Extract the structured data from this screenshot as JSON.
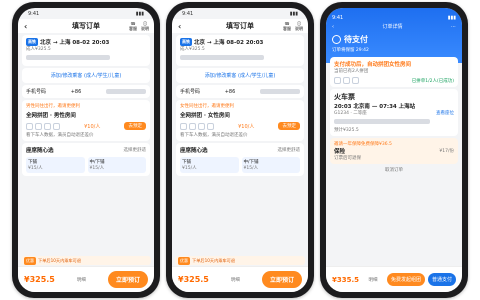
{
  "phone1": {
    "time": "9:41",
    "title": "填写订单",
    "tools": [
      "客服",
      "说明"
    ],
    "trip": "北京 → 上海  08-02 20:03",
    "train_tag": "高铁",
    "price_line": "成人¥325.5",
    "add_passenger": "添加/修改乘客 (成人/学生/儿童)",
    "phone_label": "手机号码",
    "phone_prefix": "+86",
    "room_hint": "男性同住出行，邀请更便利",
    "room_title": "全网拼团 · 男性房间",
    "room_price": "¥10/人",
    "room_btn": "去预定",
    "room_note": "看下车人数据，满员自动退还差价",
    "seat_title": "座席随心选",
    "seat_hint": "选择更舒适",
    "seat_opts": [
      {
        "name": "下铺",
        "price": "¥15/人"
      },
      {
        "name": "中/下铺",
        "price": "¥15/人"
      }
    ],
    "promo": "下单后10天内乘车可退",
    "promo_badge": "优惠",
    "total": "¥325.5",
    "detail": "明细",
    "cta": "立即预订"
  },
  "phone2": {
    "time": "9:41",
    "title": "填写订单",
    "tools": [
      "客服",
      "说明"
    ],
    "trip": "北京 → 上海  08-02 20:03",
    "train_tag": "高铁",
    "price_line": "成人¥325.5",
    "add_passenger": "添加/修改乘客 (成人/学生/儿童)",
    "phone_label": "手机号码",
    "phone_prefix": "+86",
    "room_hint": "女性同住出行，邀请更便利",
    "room_title": "全网拼团 · 女性房间",
    "room_price": "¥10/人",
    "room_btn": "去预定",
    "room_note": "看下车人数据，满员自动退还差价",
    "seat_title": "座席随心选",
    "seat_hint": "选择更舒适",
    "seat_opts": [
      {
        "name": "下铺",
        "price": "¥15/人"
      },
      {
        "name": "中/下铺",
        "price": "¥15/人"
      }
    ],
    "promo": "下单后10天内乘车可退",
    "promo_badge": "优惠",
    "total": "¥325.5",
    "detail": "明细",
    "cta": "立即预订"
  },
  "phone3": {
    "time": "9:41",
    "title": "订单详情",
    "pay_status": "待支付",
    "pay_sub": "订单将保留 29:42",
    "match_title": "支付成功后，自动拼团女性房间",
    "match_sub": "当前已有2人拼团",
    "match_progress": "已拼单1/2人(已成功)",
    "train_title": "火车票",
    "train_line": "20:03 北京南 — 07:34 上海站",
    "train_sub": "G1234 · 二等座",
    "seat_info": "查看座位",
    "refund_label": "预计¥325.5",
    "promo_banner": "邀请一年保障免费保障¥36.5",
    "insurance_title": "保险",
    "insurance_sub": "订票后可退保",
    "insurance_price": "¥17/份",
    "cancel": "取消订单",
    "total": "¥335.5",
    "detail": "明细",
    "btn1": "免费发起组团",
    "btn2": "普通支付"
  }
}
